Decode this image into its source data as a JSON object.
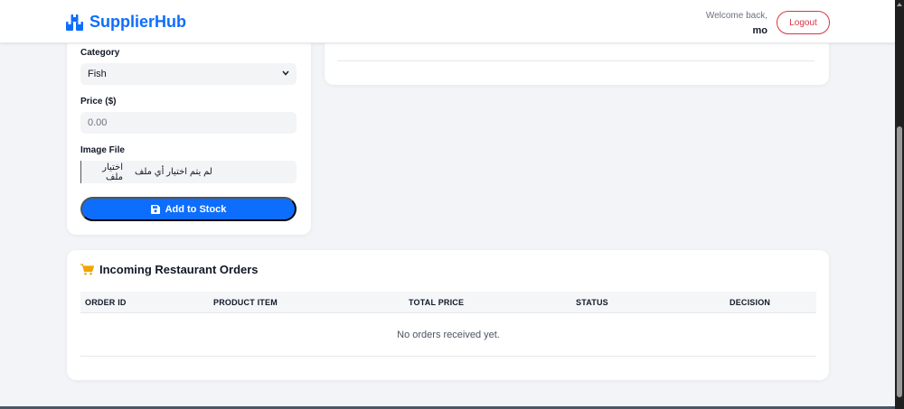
{
  "brand": {
    "name": "SupplierHub",
    "color": "#0d6efd"
  },
  "header": {
    "welcome_text": "Welcome back,",
    "username": "mo",
    "logout_label": "Logout"
  },
  "form": {
    "category_label": "Category",
    "category_value": "Fish",
    "price_label": "Price ($)",
    "price_placeholder": "0.00",
    "image_label": "Image File",
    "file_button_label": "اختيار ملف",
    "file_status": "لم يتم اختيار أي ملف",
    "submit_label": "Add to Stock"
  },
  "orders": {
    "title": "Incoming Restaurant Orders",
    "columns": [
      "ORDER ID",
      "PRODUCT ITEM",
      "TOTAL PRICE",
      "STATUS",
      "DECISION"
    ],
    "empty_message": "No orders received yet."
  },
  "icons": {
    "brand": "boxes-icon",
    "cart": "cart-icon",
    "save": "save-icon",
    "select": "chevron-down-icon"
  },
  "colors": {
    "primary": "#0d6efd",
    "danger": "#dc3545",
    "cart_icon": "#f0a500",
    "background": "#f2f4f7"
  }
}
